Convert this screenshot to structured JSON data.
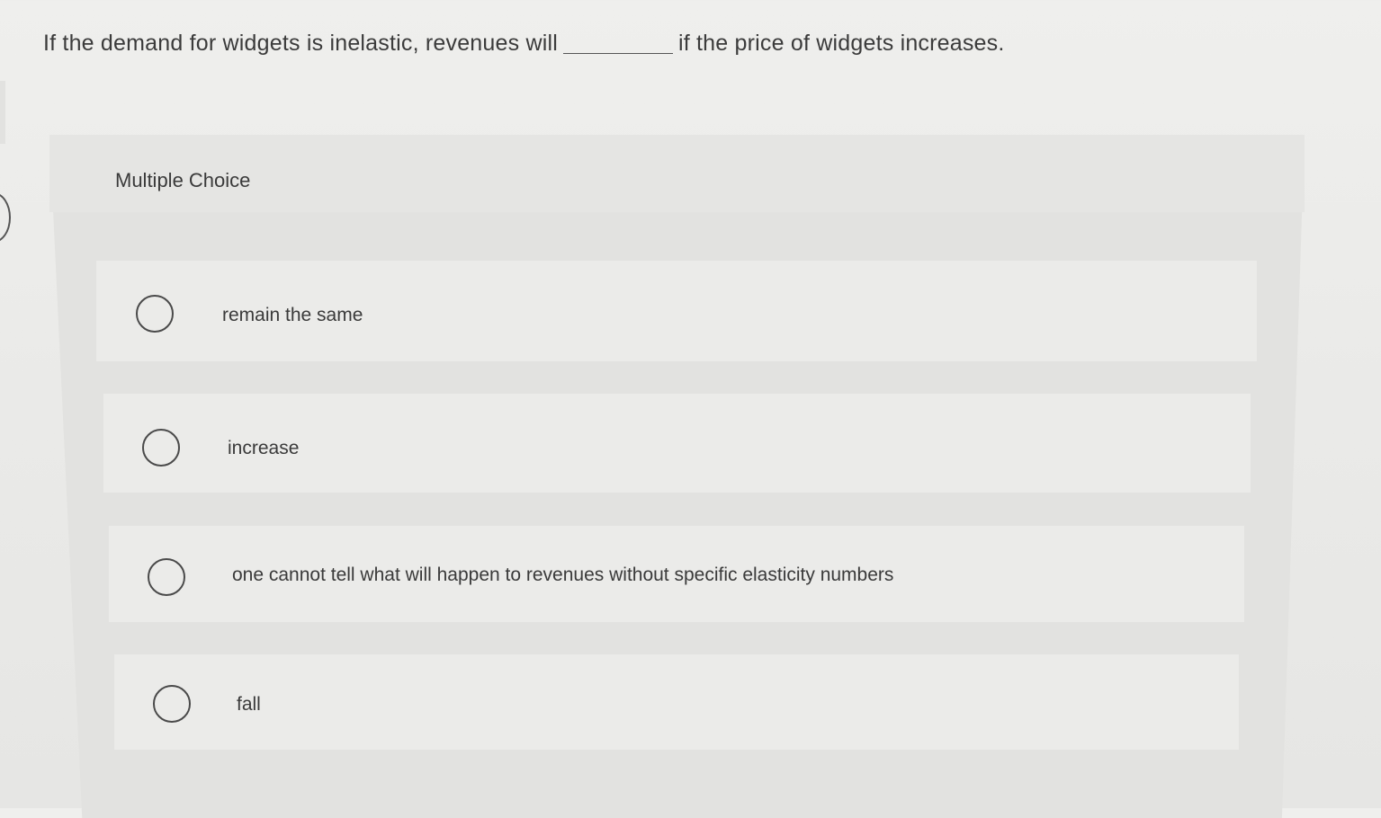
{
  "question": {
    "before_blank": "If the demand for widgets is inelastic, revenues will",
    "after_blank": "if the price of widgets increases."
  },
  "panel": {
    "label": "Multiple Choice"
  },
  "options": [
    {
      "label": "remain the same"
    },
    {
      "label": "increase"
    },
    {
      "label": "one cannot tell what will happen to revenues without specific elasticity numbers"
    },
    {
      "label": "fall"
    }
  ]
}
